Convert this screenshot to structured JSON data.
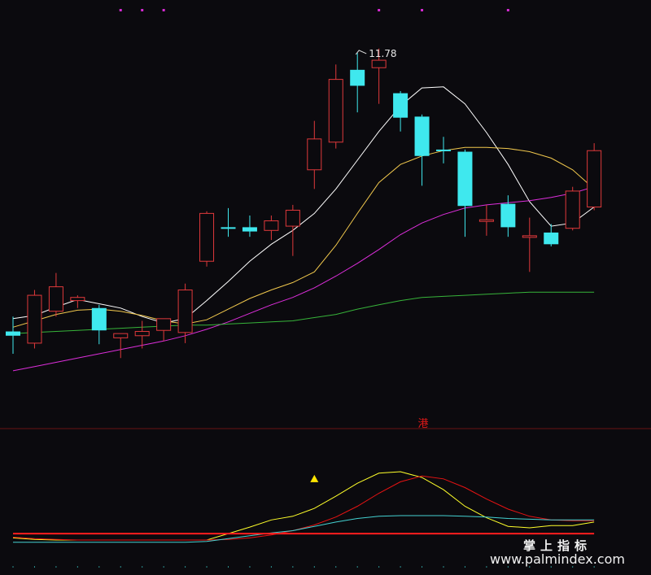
{
  "chart_data": [
    {
      "type": "candlestick",
      "title": "",
      "xlabel": "",
      "ylabel": "",
      "ylim": [
        8.3,
        12.2
      ],
      "grid": false,
      "annotations": [
        {
          "text": "11.78",
          "candle_index": 16
        }
      ],
      "candles": [
        {
          "o": 9.16,
          "h": 9.3,
          "l": 8.95,
          "c": 9.12
        },
        {
          "o": 9.05,
          "h": 9.55,
          "l": 9.0,
          "c": 9.5
        },
        {
          "o": 9.35,
          "h": 9.71,
          "l": 9.3,
          "c": 9.58
        },
        {
          "o": 9.45,
          "h": 9.5,
          "l": 9.38,
          "c": 9.48
        },
        {
          "o": 9.38,
          "h": 9.41,
          "l": 9.04,
          "c": 9.17
        },
        {
          "o": 9.1,
          "h": 9.14,
          "l": 8.91,
          "c": 9.14
        },
        {
          "o": 9.12,
          "h": 9.26,
          "l": 9.0,
          "c": 9.16
        },
        {
          "o": 9.17,
          "h": 9.25,
          "l": 9.07,
          "c": 9.28
        },
        {
          "o": 9.15,
          "h": 9.61,
          "l": 9.05,
          "c": 9.55
        },
        {
          "o": 9.82,
          "h": 10.29,
          "l": 9.77,
          "c": 10.27
        },
        {
          "o": 10.14,
          "h": 10.32,
          "l": 10.05,
          "c": 10.13
        },
        {
          "o": 10.14,
          "h": 10.25,
          "l": 10.05,
          "c": 10.1
        },
        {
          "o": 10.11,
          "h": 10.25,
          "l": 10.02,
          "c": 10.2
        },
        {
          "o": 10.15,
          "h": 10.35,
          "l": 9.87,
          "c": 10.3
        },
        {
          "o": 10.68,
          "h": 11.14,
          "l": 10.5,
          "c": 10.97
        },
        {
          "o": 10.94,
          "h": 11.67,
          "l": 10.88,
          "c": 11.53
        },
        {
          "o": 11.62,
          "h": 11.78,
          "l": 11.22,
          "c": 11.47
        },
        {
          "o": 11.64,
          "h": 11.82,
          "l": 11.3,
          "c": 11.71
        },
        {
          "o": 11.4,
          "h": 11.42,
          "l": 11.04,
          "c": 11.17
        },
        {
          "o": 11.18,
          "h": 11.2,
          "l": 10.53,
          "c": 10.81
        },
        {
          "o": 10.87,
          "h": 10.99,
          "l": 10.74,
          "c": 10.86
        },
        {
          "o": 10.85,
          "h": 10.87,
          "l": 10.05,
          "c": 10.34
        },
        {
          "o": 10.21,
          "h": 10.35,
          "l": 10.06,
          "c": 10.21
        },
        {
          "o": 10.36,
          "h": 10.44,
          "l": 10.05,
          "c": 10.14
        },
        {
          "o": 10.05,
          "h": 10.23,
          "l": 9.72,
          "c": 10.06
        },
        {
          "o": 10.09,
          "h": 10.17,
          "l": 9.96,
          "c": 9.98
        },
        {
          "o": 10.13,
          "h": 10.52,
          "l": 10.11,
          "c": 10.48
        },
        {
          "o": 10.33,
          "h": 10.93,
          "l": 10.3,
          "c": 10.86
        }
      ],
      "series": [
        {
          "color": "#ffffff",
          "values": [
            9.28,
            9.31,
            9.39,
            9.46,
            9.42,
            9.38,
            9.3,
            9.24,
            9.28,
            9.45,
            9.63,
            9.82,
            9.98,
            10.11,
            10.27,
            10.5,
            10.77,
            11.04,
            11.28,
            11.45,
            11.46,
            11.3,
            11.03,
            10.73,
            10.38,
            10.15,
            10.18,
            10.33
          ]
        },
        {
          "color": "#f1c84d",
          "values": [
            9.2,
            9.26,
            9.32,
            9.36,
            9.37,
            9.35,
            9.31,
            9.26,
            9.23,
            9.27,
            9.37,
            9.47,
            9.55,
            9.62,
            9.72,
            9.97,
            10.27,
            10.56,
            10.73,
            10.81,
            10.86,
            10.89,
            10.89,
            10.88,
            10.85,
            10.79,
            10.68,
            10.5
          ]
        },
        {
          "color": "#dd2edb",
          "values": [
            8.79,
            8.83,
            8.87,
            8.91,
            8.95,
            8.99,
            9.03,
            9.07,
            9.12,
            9.18,
            9.25,
            9.33,
            9.41,
            9.48,
            9.57,
            9.68,
            9.8,
            9.93,
            10.07,
            10.18,
            10.26,
            10.32,
            10.35,
            10.37,
            10.39,
            10.42,
            10.46,
            10.52
          ]
        },
        {
          "color": "#37b43a",
          "values": [
            9.14,
            9.15,
            9.16,
            9.17,
            9.18,
            9.19,
            9.2,
            9.21,
            9.22,
            9.22,
            9.23,
            9.24,
            9.25,
            9.26,
            9.29,
            9.32,
            9.37,
            9.41,
            9.45,
            9.48,
            9.49,
            9.5,
            9.51,
            9.52,
            9.53,
            9.53,
            9.53,
            9.53
          ]
        }
      ],
      "markers": [
        {
          "type": "dot",
          "color": "#d52ad2",
          "candle_indices": [
            5,
            6,
            7,
            17,
            19,
            23
          ]
        }
      ]
    },
    {
      "type": "line",
      "title": "",
      "xlabel": "",
      "ylabel": "",
      "ylim": [
        -0.04,
        1.0
      ],
      "grid": false,
      "labels": [
        {
          "text": "港",
          "color": "#e01818"
        }
      ],
      "series": [
        {
          "color": "#ffff2a",
          "values": [
            0.08,
            0.06,
            0.05,
            0.05,
            0.05,
            0.05,
            0.05,
            0.05,
            0.05,
            0.05,
            0.14,
            0.23,
            0.33,
            0.38,
            0.49,
            0.66,
            0.84,
            0.98,
            1.0,
            0.92,
            0.75,
            0.52,
            0.36,
            0.24,
            0.22,
            0.25,
            0.25,
            0.3
          ]
        },
        {
          "color": "#e81313",
          "values": [
            0.09,
            0.07,
            0.06,
            0.05,
            0.05,
            0.05,
            0.05,
            0.05,
            0.05,
            0.05,
            0.06,
            0.08,
            0.12,
            0.18,
            0.26,
            0.37,
            0.52,
            0.7,
            0.86,
            0.94,
            0.9,
            0.78,
            0.62,
            0.48,
            0.38,
            0.33,
            0.32,
            0.32
          ]
        },
        {
          "color": "#44d2d2",
          "values": [
            0.02,
            0.02,
            0.02,
            0.02,
            0.02,
            0.02,
            0.02,
            0.02,
            0.02,
            0.03,
            0.07,
            0.11,
            0.15,
            0.18,
            0.24,
            0.3,
            0.35,
            0.38,
            0.39,
            0.39,
            0.39,
            0.38,
            0.37,
            0.35,
            0.34,
            0.33,
            0.33,
            0.33
          ]
        },
        {
          "color": "#ff1e1e",
          "values": [
            0.14,
            0.14,
            0.14,
            0.14,
            0.14,
            0.14,
            0.14,
            0.14,
            0.14,
            0.14,
            0.14,
            0.14,
            0.14,
            0.14,
            0.14,
            0.14,
            0.14,
            0.14,
            0.14,
            0.14,
            0.14,
            0.14,
            0.14,
            0.14,
            0.14,
            0.14,
            0.14,
            0.14
          ]
        }
      ],
      "markers": [
        {
          "type": "triangle",
          "color": "#ffe500",
          "candle_index": 14,
          "value": 0.9
        }
      ]
    }
  ],
  "watermark": {
    "cn": "掌上指标",
    "url": "www.palmindex.com"
  },
  "colors": {
    "up": "#e0393b",
    "down": "#3fe8ee",
    "background": "#0b0a0e",
    "separator": "#6a1414"
  }
}
